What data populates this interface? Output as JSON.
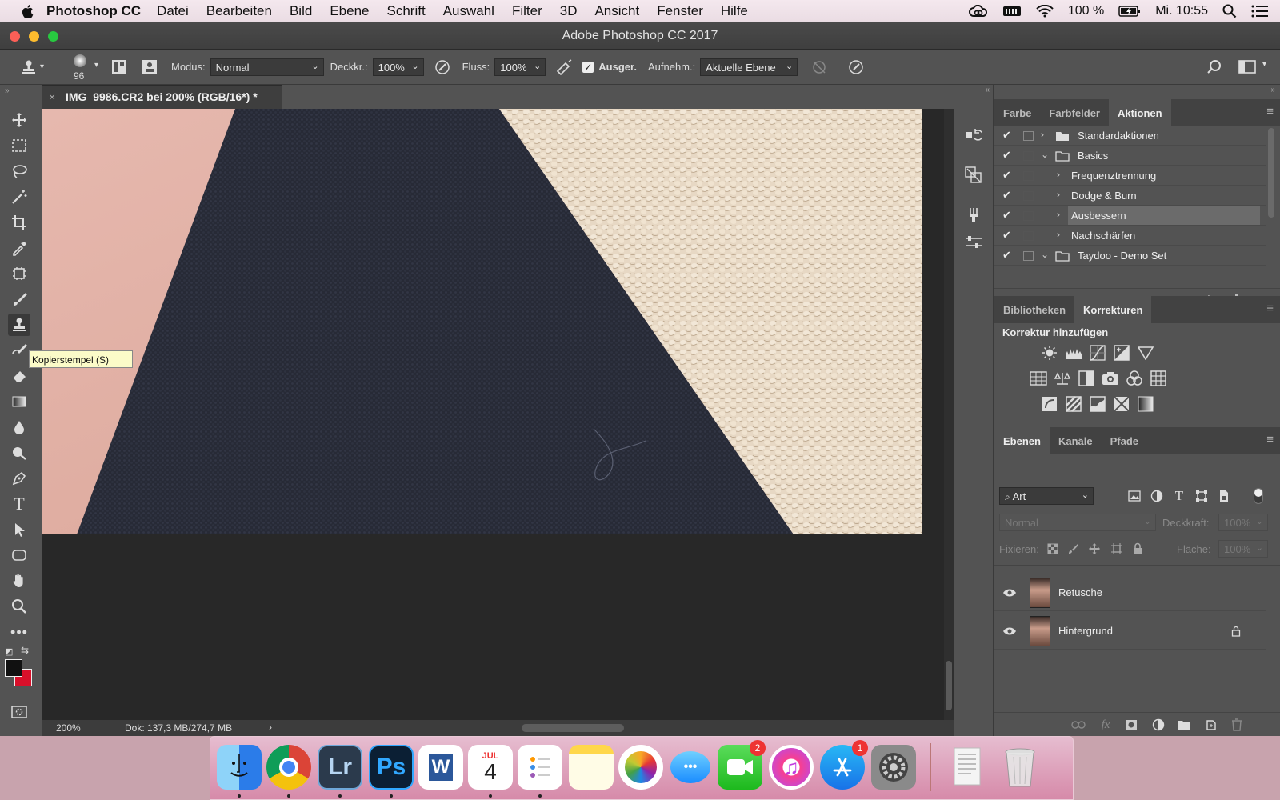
{
  "menubar": {
    "app_name": "Photoshop CC",
    "menus": [
      "Datei",
      "Bearbeiten",
      "Bild",
      "Ebene",
      "Schrift",
      "Auswahl",
      "Filter",
      "3D",
      "Ansicht",
      "Fenster",
      "Hilfe"
    ],
    "battery": "100 %",
    "clock": "Mi. 10:55",
    "icons": [
      "apple-icon",
      "creative-cloud-icon",
      "battery-menu-icon",
      "wifi-icon",
      "battery-charging-icon",
      "spotlight-search-icon",
      "notification-center-icon"
    ]
  },
  "window": {
    "title": "Adobe Photoshop CC 2017"
  },
  "options": {
    "brush_size": "96",
    "modus_label": "Modus:",
    "modus_value": "Normal",
    "deckkraft_label": "Deckkr.:",
    "deckkraft_value": "100%",
    "fluss_label": "Fluss:",
    "fluss_value": "100%",
    "ausger_label": "Ausger.",
    "ausger_checked": true,
    "aufnehm_label": "Aufnehm.:",
    "aufnehm_value": "Aktuelle Ebene"
  },
  "document": {
    "tab_title": "IMG_9986.CR2 bei 200% (RGB/16*) *",
    "zoom": "200%",
    "doc_info": "Dok: 137,3 MB/274,7 MB"
  },
  "tooltip": "Kopierstempel (S)",
  "tools": [
    "move-tool-icon",
    "marquee-tool-icon",
    "lasso-tool-icon",
    "magic-wand-icon",
    "crop-tool-icon",
    "eyedropper-icon",
    "frame-tool-icon",
    "brush-tool-icon",
    "clone-stamp-icon",
    "history-brush-icon",
    "eraser-icon",
    "gradient-tool-icon",
    "blur-tool-icon",
    "dodge-tool-icon",
    "pen-tool-icon",
    "type-tool-icon",
    "path-select-icon",
    "shape-tool-icon",
    "hand-tool-icon",
    "zoom-tool-icon",
    "more-tools-icon"
  ],
  "colors": {
    "foreground": "#111111",
    "background": "#d8102a"
  },
  "actions_panel": {
    "tabs": [
      "Farbe",
      "Farbfelder",
      "Aktionen"
    ],
    "active_tab": "Aktionen",
    "items": [
      {
        "label": "Standardaktionen",
        "type": "set",
        "expanded": false
      },
      {
        "label": "Basics",
        "type": "set",
        "expanded": true
      },
      {
        "label": "Frequenztrennung",
        "type": "action"
      },
      {
        "label": "Dodge & Burn",
        "type": "action"
      },
      {
        "label": "Ausbessern",
        "type": "action",
        "selected": true
      },
      {
        "label": "Nachschärfen",
        "type": "action"
      },
      {
        "label": "Taydoo - Demo Set",
        "type": "set",
        "expanded": true
      }
    ]
  },
  "adjustments_panel": {
    "tabs": [
      "Bibliotheken",
      "Korrekturen"
    ],
    "active_tab": "Korrekturen",
    "heading": "Korrektur hinzufügen"
  },
  "layers_panel": {
    "tabs": [
      "Ebenen",
      "Kanäle",
      "Pfade"
    ],
    "active_tab": "Ebenen",
    "filter_label": "Art",
    "blend_mode": "Normal",
    "opacity_label": "Deckkraft:",
    "opacity_value": "100%",
    "lock_label": "Fixieren:",
    "fill_label": "Fläche:",
    "fill_value": "100%",
    "layers": [
      {
        "name": "Retusche",
        "visible": true,
        "locked": false
      },
      {
        "name": "Hintergrund",
        "visible": true,
        "locked": true
      }
    ]
  },
  "dock": {
    "apps": [
      "Finder",
      "Chrome",
      "Lightroom",
      "Photoshop",
      "Word",
      "Kalender",
      "Erinnerungen",
      "Notizen",
      "Fotos",
      "Nachrichten",
      "FaceTime",
      "iTunes",
      "App Store",
      "Systemeinstellungen",
      "Dokumente",
      "Papierkorb"
    ],
    "lightroom_label": "Lr",
    "photoshop_label": "Ps",
    "calendar_month": "JUL",
    "calendar_day": "4",
    "facetime_badge": "2",
    "appstore_badge": "1"
  }
}
